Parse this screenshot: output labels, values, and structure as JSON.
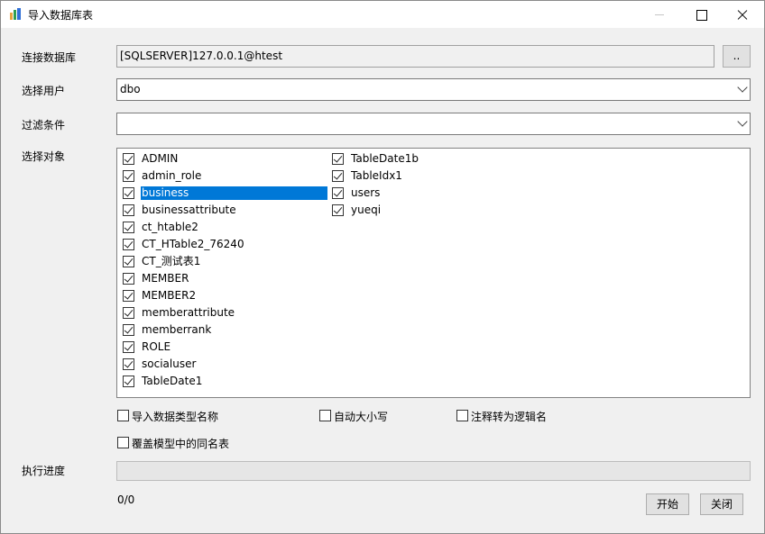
{
  "window": {
    "title": "导入数据库表"
  },
  "form": {
    "db_label": "连接数据库",
    "db_value": "[SQLSERVER]127.0.0.1@htest",
    "browse_label": "..",
    "user_label": "选择用户",
    "user_value": "dbo",
    "filter_label": "过滤条件",
    "filter_value": "",
    "objects_label": "选择对象"
  },
  "objects": {
    "col1": [
      {
        "label": "ADMIN",
        "checked": true,
        "selected": false
      },
      {
        "label": "admin_role",
        "checked": true,
        "selected": false
      },
      {
        "label": "business",
        "checked": true,
        "selected": true
      },
      {
        "label": "businessattribute",
        "checked": true,
        "selected": false
      },
      {
        "label": "ct_htable2",
        "checked": true,
        "selected": false
      },
      {
        "label": "CT_HTable2_76240",
        "checked": true,
        "selected": false
      },
      {
        "label": "CT_测试表1",
        "checked": true,
        "selected": false
      },
      {
        "label": "MEMBER",
        "checked": true,
        "selected": false
      },
      {
        "label": "MEMBER2",
        "checked": true,
        "selected": false
      },
      {
        "label": "memberattribute",
        "checked": true,
        "selected": false
      },
      {
        "label": "memberrank",
        "checked": true,
        "selected": false
      },
      {
        "label": "ROLE",
        "checked": true,
        "selected": false
      },
      {
        "label": "socialuser",
        "checked": true,
        "selected": false
      },
      {
        "label": "TableDate1",
        "checked": true,
        "selected": false
      }
    ],
    "col2": [
      {
        "label": "TableDate1b",
        "checked": true,
        "selected": false
      },
      {
        "label": "TableIdx1",
        "checked": true,
        "selected": false
      },
      {
        "label": "users",
        "checked": true,
        "selected": false
      },
      {
        "label": "yueqi",
        "checked": true,
        "selected": false
      }
    ]
  },
  "options": {
    "import_type_name": {
      "label": "导入数据类型名称",
      "checked": false
    },
    "auto_case": {
      "label": "自动大小写",
      "checked": false
    },
    "comment_to_logical": {
      "label": "注释转为逻辑名",
      "checked": false
    },
    "overwrite_same_name": {
      "label": "覆盖模型中的同名表",
      "checked": false
    }
  },
  "progress": {
    "label": "执行进度",
    "fraction": 0,
    "count_text": "0/0"
  },
  "buttons": {
    "start": "开始",
    "close": "关闭"
  },
  "colors": {
    "selection": "#0078d7",
    "progress_fill": "#06b025"
  }
}
